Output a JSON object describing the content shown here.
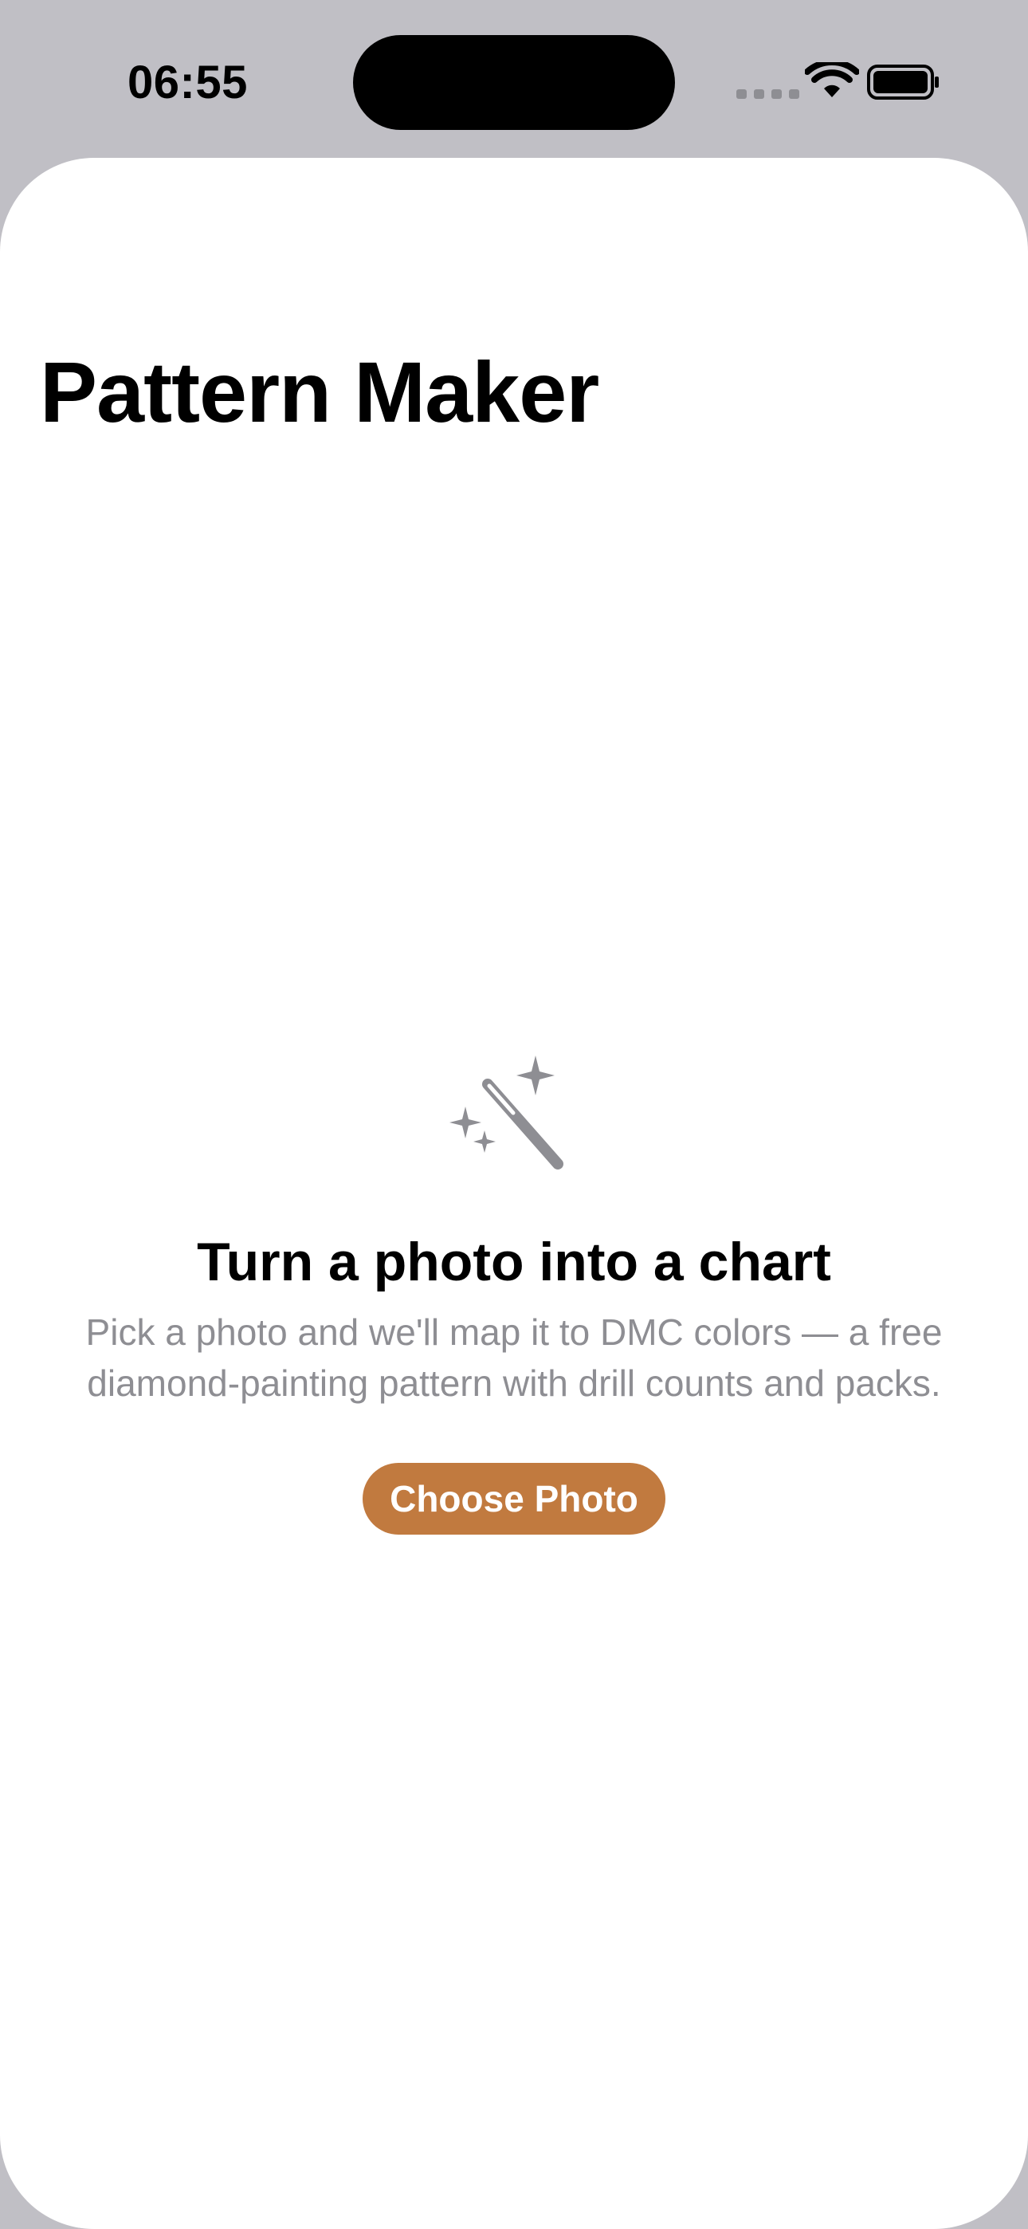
{
  "status_bar": {
    "time": "06:55",
    "icons": [
      "cellular-signal-icon",
      "wifi-icon",
      "battery-icon"
    ]
  },
  "header": {
    "title": "Pattern Maker"
  },
  "empty_state": {
    "icon": "magic-wand-icon",
    "heading": "Turn a photo into a chart",
    "body": "Pick a photo and we'll map it to DMC colors — a free diamond-painting pattern with drill counts and packs.",
    "button_label": "Choose Photo"
  },
  "colors": {
    "accent": "#c17a3f",
    "secondary_text": "#8e8e93",
    "icon_gray": "#8e8e93",
    "status_background": "#c0bfc5"
  }
}
